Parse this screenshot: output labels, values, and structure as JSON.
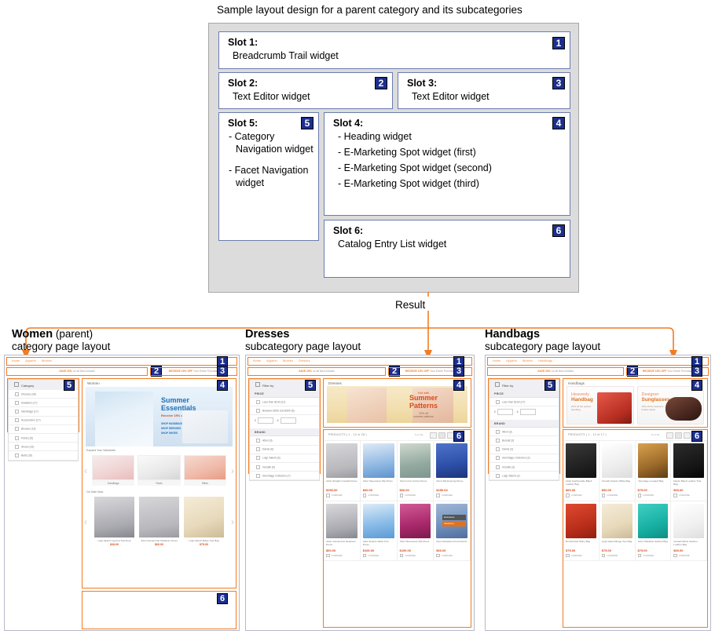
{
  "diagram": {
    "title": "Sample layout design for a parent category and its subcategories",
    "slots": [
      {
        "n": "1",
        "title": "Slot 1:",
        "items": [
          "Breadcrumb Trail widget"
        ]
      },
      {
        "n": "2",
        "title": "Slot 2:",
        "items": [
          "Text Editor widget"
        ]
      },
      {
        "n": "3",
        "title": "Slot 3:",
        "items": [
          "Text Editor widget"
        ]
      },
      {
        "n": "4",
        "title": "Slot 4:",
        "items": [
          "- Heading widget",
          "- E-Marketing Spot widget (first)",
          "- E-Marketing Spot widget (second)",
          "- E-Marketing Spot widget (third)"
        ]
      },
      {
        "n": "5",
        "title": "Slot 5:",
        "items": [
          "- Category Navigation widget",
          "- Facet Navigation widget"
        ]
      },
      {
        "n": "6",
        "title": "Slot 6:",
        "items": [
          "Catalog Entry List widget"
        ]
      }
    ]
  },
  "result_label": "Result",
  "colors": {
    "accent_orange": "#f47b20",
    "badge_navy": "#1c2f8e",
    "price_red": "#d9491d",
    "panel_gray": "#dcdcdc"
  },
  "layouts": {
    "women": {
      "caption_bold": "Women",
      "caption_rest": " (parent)",
      "caption_line2": "category page layout",
      "badges": [
        "1",
        "2",
        "3",
        "4",
        "5",
        "6"
      ],
      "breadcrumb": [
        "Home",
        "Apparel",
        "Women"
      ],
      "promo_left_bold": "SAVE 20%",
      "promo_left_rest": " on all New Arrivals",
      "promo_right_bold": "RECEIVE 15% OFF",
      "promo_right_rest": " Your Entire Purchase",
      "page_title": "Women",
      "facet_header": "Category",
      "facets": [
        "Dresses (28)",
        "Sweaters (17)",
        "Handbags (17)",
        "Accessories (17)",
        "Blouses (16)",
        "Pants (16)",
        "Shoes (16)",
        "Belts (16)"
      ],
      "hero": {
        "line1": "Summer",
        "line2": "Essentials",
        "sub": "Receive 15% off",
        "links": [
          "SHOP HANDBAGS",
          "SHOP DRESSES",
          "SHOP SHOES"
        ]
      },
      "section_wardrobe": "Expand Your Wardrobe",
      "wardrobe": [
        {
          "caption": "Handbags",
          "img": "hb-1"
        },
        {
          "caption": "Pants",
          "img": "hb-2"
        },
        {
          "caption": "Skirts",
          "img": "hb-3"
        }
      ],
      "section_sale": "On Sale Now",
      "sale_items": [
        {
          "name": "Luigi Valenti Layered Sundress",
          "price": "$28.00",
          "img": "dress-e"
        },
        {
          "name": "Attori Casual Knit Strapless Dress",
          "price": "$60.00",
          "img": "dress-a"
        },
        {
          "name": "Luigi Valenti Beige Tote Bag",
          "price": "$75.00",
          "img": "bag-6"
        }
      ]
    },
    "dresses": {
      "caption_bold": "Dresses",
      "caption_line2": "subcategory page layout",
      "badges": [
        "1",
        "2",
        "3",
        "4",
        "5",
        "6"
      ],
      "breadcrumb": [
        "Home",
        "Apparel",
        "Women",
        "Dresses"
      ],
      "promo_left_bold": "SAVE 20%",
      "promo_left_rest": " on all New Arrivals",
      "promo_right_bold": "RECEIVE 15% OFF",
      "promo_right_rest": " Your Entire Purchase",
      "page_title": "Dresses",
      "filter_header": "Filter by",
      "groups": [
        {
          "title": "PRICE",
          "rows": [
            "Less than $100 (21)",
            "Between $200 and $300 (6)"
          ],
          "price_inputs": true
        },
        {
          "title": "BRAND",
          "rows": [
            "Attori (9)",
            "Dainis (6)",
            "Luigi Valenti (6)",
            "Versatti (6)",
            "Hermitage Collection (7)"
          ]
        }
      ],
      "hero": {
        "line1": "Hot with",
        "line2": "Summer",
        "line3": "Patterns",
        "sub1": "20% off",
        "sub2": "summer patterns"
      },
      "products_label": "PRODUCTS ( 1 - 12 of 28 )",
      "sort_label": "Sort By",
      "products": [
        {
          "name": "Attori Straight Cocktail Dress",
          "price": "$250.00",
          "img": "dress-a"
        },
        {
          "name": "Attori Sleeveless Slip Dress",
          "price": "$60.00",
          "img": "dress-b"
        },
        {
          "name": "Attori A-line Cotton Dress",
          "price": "$60.00",
          "img": "dress-c"
        },
        {
          "name": "Attori Silk Evening Dress",
          "price": "$250.00",
          "img": "dress-d"
        },
        {
          "name": "Attori Casual Knit Strapless Dress",
          "price": "$60.00",
          "img": "dress-e"
        },
        {
          "name": "Attori Empire Waist Knit Dress",
          "price": "$100.00",
          "img": "dress-f"
        },
        {
          "name": "Attori Sleeveless Silk Dress",
          "price": "$100.00",
          "img": "dress-g"
        },
        {
          "name": "Attori Strapless Pencil Dress",
          "price": "$60.00",
          "img": "dress-h"
        }
      ],
      "tooltip": {
        "line1": "Exclusives",
        "line2": "Clearance"
      }
    },
    "handbags": {
      "caption_bold": "Handbags",
      "caption_line2": "subcategory page layout",
      "badges": [
        "1",
        "2",
        "3",
        "4",
        "5",
        "6"
      ],
      "breadcrumb": [
        "Home",
        "Apparel",
        "Women",
        "Handbags"
      ],
      "promo_left_bold": "SAVE 20%",
      "promo_left_rest": " on all New Arrivals",
      "promo_right_bold": "RECEIVE 15% OFF",
      "promo_right_rest": " Your Entire Purchase",
      "page_title": "Handbags",
      "filter_header": "Filter by",
      "groups": [
        {
          "title": "PRICE",
          "rows": [
            "Less than $100 (17)"
          ],
          "price_inputs": true
        },
        {
          "title": "BRAND",
          "rows": [
            "Attori (3)",
            "Borsati (3)",
            "Dainis (3)",
            "Hermitage Collection (3)",
            "Versatti (3)",
            "Luigi Valenti (2)"
          ]
        }
      ],
      "hero_left": {
        "line1": "Heavenly",
        "line2": "Handbag",
        "sub1": "20% off the perfect",
        "sub2": "handbag"
      },
      "hero_right": {
        "line1": "Designer",
        "line2": "Sunglasses",
        "sub1": "15% off the season's",
        "sub2": "hottest styles"
      },
      "products_label": "PRODUCTS ( 1 - 12 of 17 )",
      "sort_label": "Sort By",
      "products": [
        {
          "name": "Attori Fashionable Black Leather Bag",
          "price": "$60.00",
          "img": "bag-1"
        },
        {
          "name": "Versatti Classic White Bag",
          "price": "$60.00",
          "img": "bag-2"
        },
        {
          "name": "Hermitage Leopard Bag",
          "price": "$75.00",
          "img": "bag-3"
        },
        {
          "name": "Dainis Black Leather Tote Bag",
          "price": "$60.00",
          "img": "bag-4"
        },
        {
          "name": "Borsati Red Shiny Bag",
          "price": "$75.00",
          "img": "bag-5"
        },
        {
          "name": "Luigi Valenti Beige Tote Bag",
          "price": "$75.00",
          "img": "bag-6"
        },
        {
          "name": "Attori Hawaiian Satchel Bag",
          "price": "$75.00",
          "img": "bag-7"
        },
        {
          "name": "Versatti White Satchel Leather Bag",
          "price": "$60.00",
          "img": "bag-8"
        }
      ]
    }
  }
}
